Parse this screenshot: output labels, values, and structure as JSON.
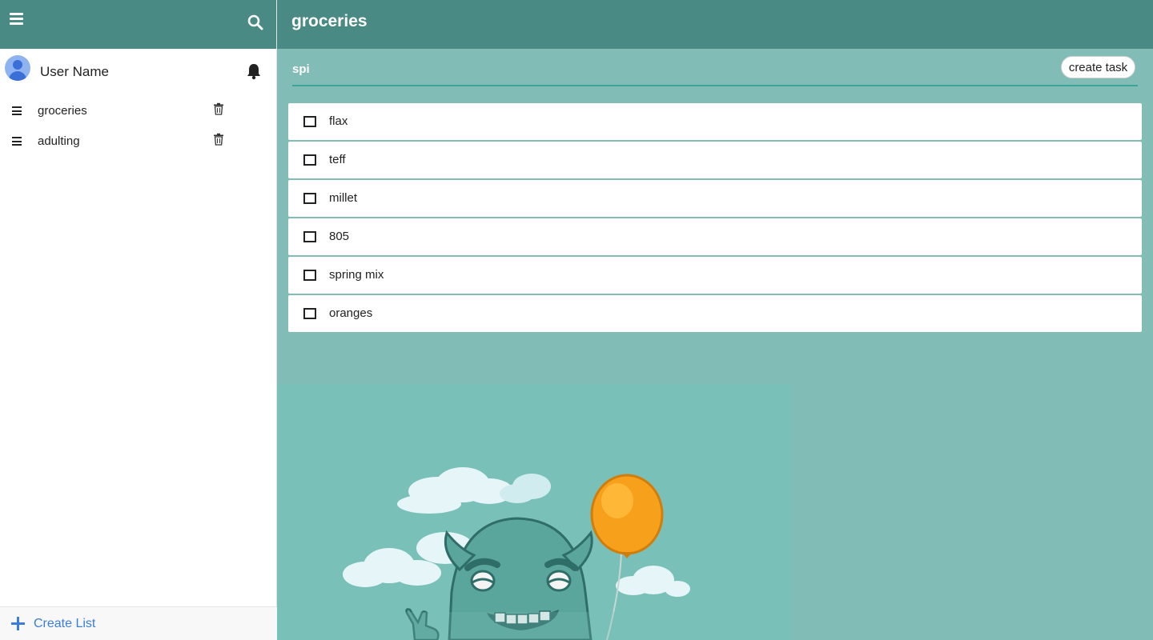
{
  "sidebar": {
    "user_name": "User Name",
    "lists": [
      {
        "label": "groceries"
      },
      {
        "label": "adulting"
      }
    ],
    "create_list_label": "Create List"
  },
  "main": {
    "title": "groceries",
    "input_value": "spi",
    "create_task_label": "create task",
    "tasks": [
      {
        "label": "flax",
        "checked": false
      },
      {
        "label": "teff",
        "checked": false
      },
      {
        "label": "millet",
        "checked": false
      },
      {
        "label": "805",
        "checked": false
      },
      {
        "label": "spring mix",
        "checked": false
      },
      {
        "label": "oranges",
        "checked": false
      }
    ]
  },
  "icons": {
    "menu": "hamburger-icon",
    "search": "search-icon",
    "avatar": "user-avatar-icon",
    "notifications": "bell-icon",
    "list_handle": "drag-handle-icon",
    "delete": "trash-icon",
    "add": "plus-icon"
  },
  "colors": {
    "header": "#4a8a85",
    "main_background": "#82bcb6",
    "accent": "#3b7dd8",
    "input_underline": "#3aa596",
    "balloon": "#f7a01b"
  }
}
